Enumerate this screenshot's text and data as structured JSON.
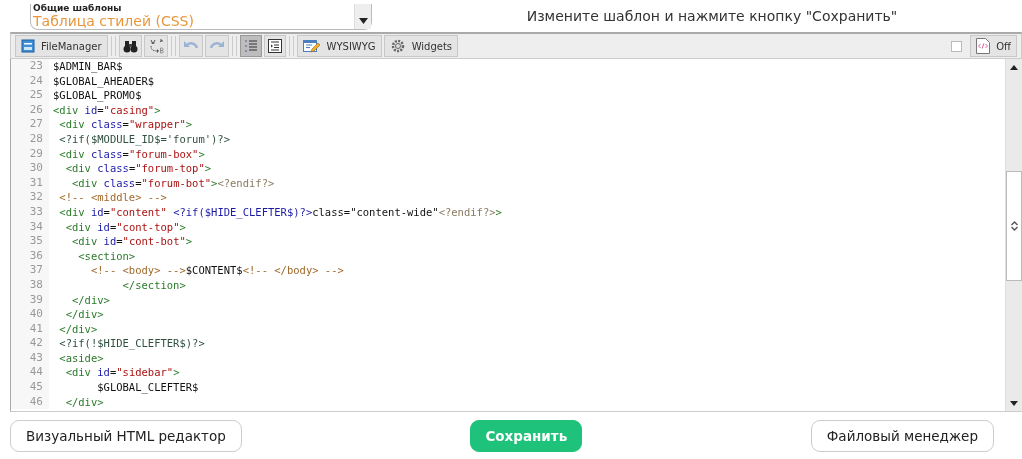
{
  "template_list": {
    "group": "Общие шаблоны",
    "item": "Таблица стилей (CSS)"
  },
  "hint": "Измените шаблон и нажмите кнопку \"Сохранить\"",
  "toolbar": {
    "file_manager": {
      "label": "FileManager"
    },
    "undo": {
      "disabled": true
    },
    "redo": {
      "disabled": true
    },
    "line_numbers": {
      "selected": true
    },
    "wysiwyg": {
      "label": "WYSIWYG"
    },
    "widgets": {
      "label": "Widgets"
    },
    "wrap_checkbox": {
      "checked": false
    },
    "toggle": {
      "label": "Off"
    }
  },
  "code_lines": [
    {
      "no": "23",
      "parts": [
        {
          "kind": "plain",
          "text": "$ADMIN_BAR$"
        }
      ]
    },
    {
      "no": "24",
      "parts": [
        {
          "kind": "plain",
          "text": "$GLOBAL_AHEADER$"
        }
      ]
    },
    {
      "no": "25",
      "parts": [
        {
          "kind": "plain",
          "text": "$GLOBAL_PROMO$"
        }
      ]
    },
    {
      "no": "26",
      "parts": [
        {
          "kind": "tag",
          "text": "<div"
        },
        {
          "kind": "attr",
          "text": " id"
        },
        {
          "kind": "plain",
          "text": "="
        },
        {
          "kind": "str",
          "text": "\"casing\""
        },
        {
          "kind": "tag",
          "text": ">"
        }
      ]
    },
    {
      "no": "27",
      "parts": [
        {
          "kind": "tag",
          "text": " <div"
        },
        {
          "kind": "attr",
          "text": " class"
        },
        {
          "kind": "plain",
          "text": "="
        },
        {
          "kind": "str",
          "text": "\"wrapper\""
        },
        {
          "kind": "tag",
          "text": ">"
        }
      ]
    },
    {
      "no": "28",
      "parts": [
        {
          "kind": "meta",
          "text": " <?if($MODULE_ID$='forum')?>"
        }
      ]
    },
    {
      "no": "29",
      "parts": [
        {
          "kind": "tag",
          "text": " <div"
        },
        {
          "kind": "attr",
          "text": " class"
        },
        {
          "kind": "plain",
          "text": "="
        },
        {
          "kind": "str",
          "text": "\"forum-box\""
        },
        {
          "kind": "tag",
          "text": ">"
        }
      ]
    },
    {
      "no": "30",
      "parts": [
        {
          "kind": "tag",
          "text": "  <div"
        },
        {
          "kind": "attr",
          "text": " class"
        },
        {
          "kind": "plain",
          "text": "="
        },
        {
          "kind": "str",
          "text": "\"forum-top\""
        },
        {
          "kind": "tag",
          "text": ">"
        }
      ]
    },
    {
      "no": "31",
      "parts": [
        {
          "kind": "tag",
          "text": "   <div"
        },
        {
          "kind": "attr",
          "text": " class"
        },
        {
          "kind": "plain",
          "text": "="
        },
        {
          "kind": "str",
          "text": "\"forum-bot\""
        },
        {
          "kind": "tag",
          "text": ">"
        },
        {
          "kind": "pi",
          "text": "<?endif?>"
        }
      ]
    },
    {
      "no": "32",
      "parts": [
        {
          "kind": "comment",
          "text": " <!-- <middle> -->"
        }
      ]
    },
    {
      "no": "33",
      "parts": [
        {
          "kind": "tag",
          "text": " <div"
        },
        {
          "kind": "attr",
          "text": " id"
        },
        {
          "kind": "plain",
          "text": "="
        },
        {
          "kind": "str",
          "text": "\"content\" "
        },
        {
          "kind": "var",
          "text": "<?if($HIDE_CLEFTER$)?>"
        },
        {
          "kind": "plain",
          "text": "class=\"content-wide\""
        },
        {
          "kind": "pi",
          "text": "<?endif?>"
        },
        {
          "kind": "tag",
          "text": ">"
        }
      ]
    },
    {
      "no": "34",
      "parts": [
        {
          "kind": "tag",
          "text": "  <div"
        },
        {
          "kind": "attr",
          "text": " id"
        },
        {
          "kind": "plain",
          "text": "="
        },
        {
          "kind": "str",
          "text": "\"cont-top\""
        },
        {
          "kind": "tag",
          "text": ">"
        }
      ]
    },
    {
      "no": "35",
      "parts": [
        {
          "kind": "tag",
          "text": "   <div"
        },
        {
          "kind": "attr",
          "text": " id"
        },
        {
          "kind": "plain",
          "text": "="
        },
        {
          "kind": "str",
          "text": "\"cont-bot\""
        },
        {
          "kind": "tag",
          "text": ">"
        }
      ]
    },
    {
      "no": "36",
      "parts": [
        {
          "kind": "tag",
          "text": "    <section>"
        }
      ]
    },
    {
      "no": "37",
      "parts": [
        {
          "kind": "comment",
          "text": "      <!-- <body> -->"
        },
        {
          "kind": "plain",
          "text": "$CONTENT$"
        },
        {
          "kind": "comment",
          "text": "<!-- </body> -->"
        }
      ]
    },
    {
      "no": "38",
      "parts": [
        {
          "kind": "tag",
          "text": "           </section>"
        }
      ]
    },
    {
      "no": "39",
      "parts": [
        {
          "kind": "tag",
          "text": "   </div>"
        }
      ]
    },
    {
      "no": "40",
      "parts": [
        {
          "kind": "tag",
          "text": "  </div>"
        }
      ]
    },
    {
      "no": "41",
      "parts": [
        {
          "kind": "tag",
          "text": " </div>"
        }
      ]
    },
    {
      "no": "42",
      "parts": [
        {
          "kind": "meta",
          "text": " <?if(!$HIDE_CLEFTER$)?>"
        }
      ]
    },
    {
      "no": "43",
      "parts": [
        {
          "kind": "tag",
          "text": " <aside>"
        }
      ]
    },
    {
      "no": "44",
      "parts": [
        {
          "kind": "tag",
          "text": "  <div"
        },
        {
          "kind": "attr",
          "text": " id"
        },
        {
          "kind": "plain",
          "text": "="
        },
        {
          "kind": "str",
          "text": "\"sidebar\""
        },
        {
          "kind": "tag",
          "text": ">"
        }
      ]
    },
    {
      "no": "45",
      "parts": [
        {
          "kind": "plain",
          "text": "       $GLOBAL_CLEFTER$"
        }
      ]
    },
    {
      "no": "46",
      "parts": [
        {
          "kind": "tag",
          "text": "  </div>"
        }
      ]
    }
  ],
  "buttons": {
    "visual_editor": "Визуальный HTML редактор",
    "save": "Сохранить",
    "file_manager": "Файловый менеджер"
  }
}
